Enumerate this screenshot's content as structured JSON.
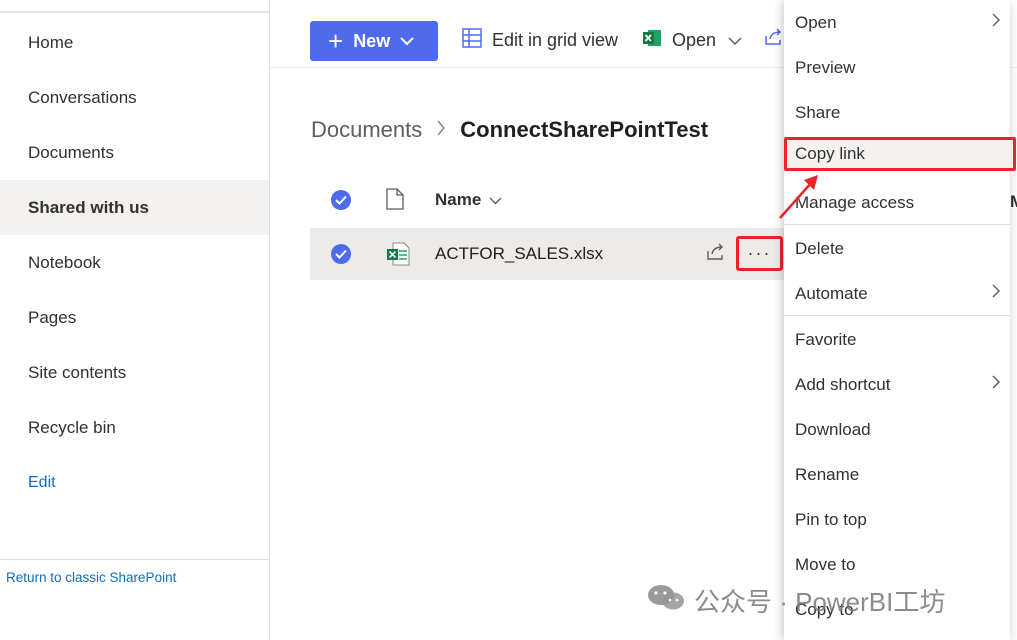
{
  "sidenav": {
    "items": [
      {
        "label": "Home"
      },
      {
        "label": "Conversations"
      },
      {
        "label": "Documents"
      },
      {
        "label": "Shared with us",
        "selected": true
      },
      {
        "label": "Notebook"
      },
      {
        "label": "Pages"
      },
      {
        "label": "Site contents"
      },
      {
        "label": "Recycle bin"
      }
    ],
    "edit_label": "Edit",
    "classic_link": "Return to classic SharePoint"
  },
  "toolbar": {
    "new_label": "New",
    "grid_view_label": "Edit in grid view",
    "open_label": "Open"
  },
  "breadcrumb": {
    "root": "Documents",
    "current": "ConnectSharePointTest"
  },
  "list": {
    "column_name": "Name",
    "files": [
      {
        "name": "ACTFOR_SALES.xlsx",
        "selected": true
      }
    ]
  },
  "context_menu": {
    "items": [
      {
        "label": "Open",
        "submenu": true
      },
      {
        "label": "Preview"
      },
      {
        "label": "Share"
      },
      {
        "label": "Copy link",
        "highlighted": true
      },
      {
        "label": "Manage access"
      },
      {
        "label": "Delete"
      },
      {
        "label": "Automate",
        "submenu": true
      },
      {
        "label": "Favorite"
      },
      {
        "label": "Add shortcut",
        "submenu": true
      },
      {
        "label": "Download"
      },
      {
        "label": "Rename"
      },
      {
        "label": "Pin to top"
      },
      {
        "label": "Move to"
      },
      {
        "label": "Copy to"
      }
    ]
  },
  "watermark": {
    "text": "公众号 · PowerBI工坊"
  },
  "colors": {
    "accent": "#4f6bed",
    "annotation": "#e8262a",
    "excel": "#107c41"
  }
}
